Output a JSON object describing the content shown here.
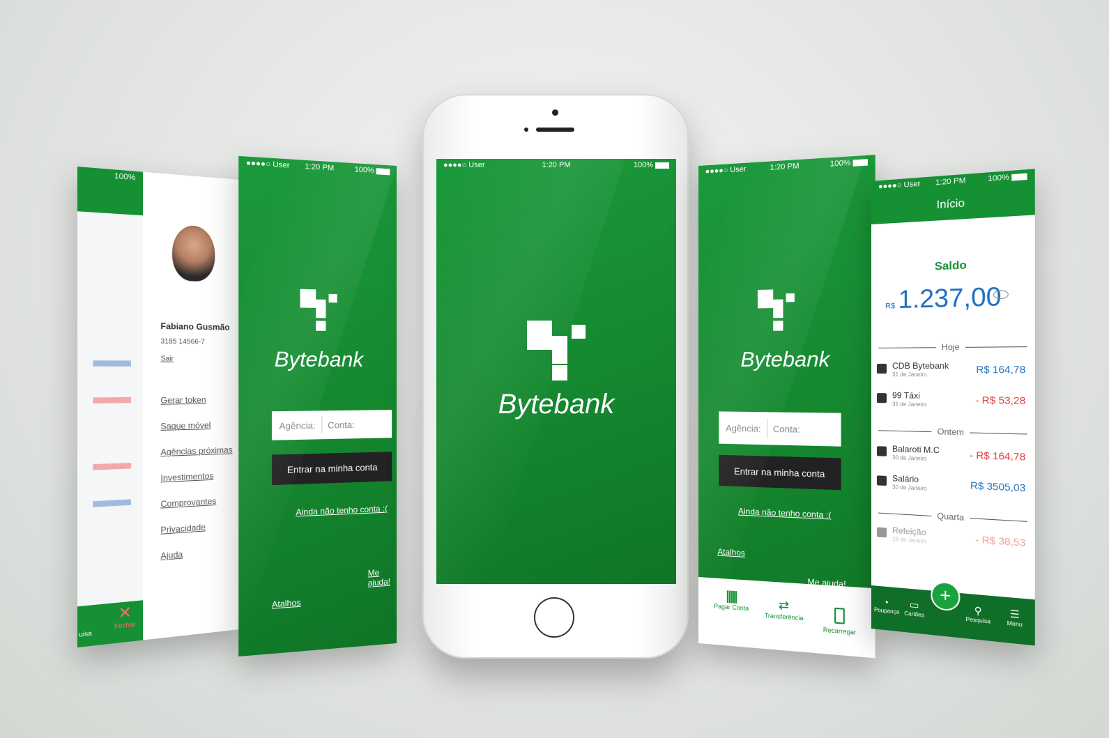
{
  "brand": {
    "name": "Bytebank",
    "green": "#159033",
    "dark": "#222222",
    "blue": "#1e6fc0",
    "red": "#e23b3b"
  },
  "status_bar": {
    "carrier": "●●●●○ User",
    "time": "1:20 PM",
    "battery": "100%"
  },
  "login": {
    "agency_placeholder": "Agência:",
    "account_placeholder": "Conta:",
    "login_button": "Entrar na minha conta",
    "signup_link": "Ainda não tenho conta :(",
    "help_link": "Me ajuda!",
    "shortcuts_link": "Atalhos"
  },
  "shortcuts": {
    "items": [
      {
        "label": "Pagar Conta",
        "icon": "barcode-icon"
      },
      {
        "label": "Transferência",
        "icon": "transfer-icon"
      },
      {
        "label": "Recarregar",
        "icon": "phone-icon"
      }
    ]
  },
  "menu": {
    "user_name": "Fabiano Gusmão",
    "account_number": "3185 14566-7",
    "logout": "Sair",
    "items": [
      "Gerar token",
      "Saque móvel",
      "Agências próximas",
      "Investimentos",
      "Comprovantes",
      "Privacidade",
      "Ajuda"
    ],
    "close_label": "Fechar",
    "search_label_partial": "uisa"
  },
  "dashboard": {
    "title": "Início",
    "balance_label": "Saldo",
    "currency": "R$",
    "balance": "1.237,00",
    "groups": [
      {
        "label": "Hoje",
        "items": [
          {
            "name": "CDB Bytebank",
            "date": "31 de Janeiro",
            "amount": "R$ 164,78",
            "type": "credit"
          },
          {
            "name": "99 Táxi",
            "date": "31 de Janeiro",
            "amount": "- R$ 53,28",
            "type": "debit"
          }
        ]
      },
      {
        "label": "Ontem",
        "items": [
          {
            "name": "Balaroti M.C",
            "date": "30 de Janeiro",
            "amount": "- R$ 164,78",
            "type": "debit"
          },
          {
            "name": "Salário",
            "date": "30 de Janeiro",
            "amount": "R$ 3505,03",
            "type": "credit"
          }
        ]
      },
      {
        "label": "Quarta",
        "items": [
          {
            "name": "Refeição",
            "date": "29 de Janeiro",
            "amount": "- R$ 38,53",
            "type": "debit"
          }
        ]
      }
    ],
    "tabbar": {
      "savings": "Poupança",
      "cards": "Cartões",
      "search": "Pesquisa",
      "menu": "Menu"
    }
  }
}
